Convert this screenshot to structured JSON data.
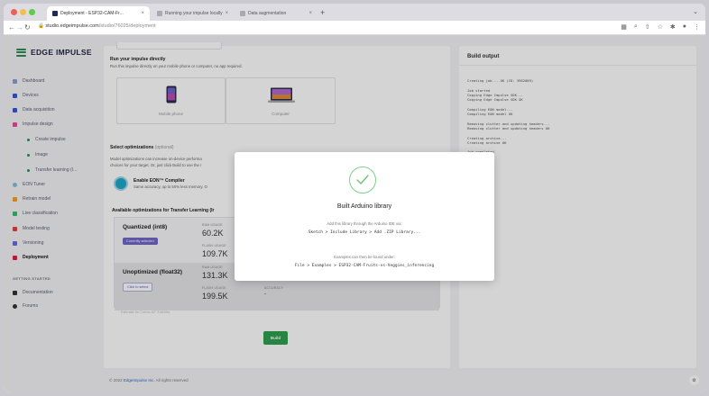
{
  "browser": {
    "tabs": [
      {
        "label": "Deployment - ESP32-CAM-Fr..."
      },
      {
        "label": "Running your impulse locally"
      },
      {
        "label": "Data augmentation"
      }
    ],
    "new_tab": "+",
    "url_host": "studio.edgeimpulse.com",
    "url_path": "/studio/76025/deployment"
  },
  "app": {
    "brand": "EDGE IMPULSE",
    "nav": [
      {
        "label": "Dashboard",
        "color": "#8aa0c8"
      },
      {
        "label": "Devices",
        "color": "#3a58c9"
      },
      {
        "label": "Data acquisition",
        "color": "#3a58c9"
      },
      {
        "label": "Impulse design",
        "color": "#e0509a"
      }
    ],
    "subnav": [
      "Create impulse",
      "Image",
      "Transfer learning (I..."
    ],
    "nav2": [
      {
        "label": "EON Tuner",
        "color": "#7fc2d9"
      },
      {
        "label": "Retrain model",
        "color": "#f0a030"
      },
      {
        "label": "Live classification",
        "color": "#40b870"
      },
      {
        "label": "Model testing",
        "color": "#e04040"
      },
      {
        "label": "Versioning",
        "color": "#6a6adc"
      },
      {
        "label": "Deployment",
        "color": "#e02040"
      }
    ],
    "section": "GETTING STARTED",
    "nav3": [
      {
        "label": "Documentation",
        "color": "#333"
      },
      {
        "label": "Forums",
        "color": "#333"
      }
    ]
  },
  "main": {
    "run_title": "Run your impulse directly",
    "run_text": "Run this impulse directly on your mobile phone or computer, no app required.",
    "mobile_label": "Mobile phone",
    "computer_label": "Computer",
    "opt_title": "Select optimizations",
    "opt_title_suffix": "(optional)",
    "opt_text1": "Model optimizations can increase on-device performa",
    "opt_text2": "choices for your target. Or, just click Build to use the r",
    "eon_title": "Enable EON™ Compiler",
    "eon_text": "Same accuracy, up to 50% less memory. O",
    "available": "Available optimizations for Transfer Learning (Ir",
    "quantized": {
      "name": "Quantized (int8)",
      "badge": "Currently selected",
      "ram_label": "RAM USAGE",
      "ram": "60.2K",
      "flash_label": "FLASH USAGE",
      "flash": "109.7K"
    },
    "unoptimized": {
      "name": "Unoptimized (float32)",
      "badge": "Click to select",
      "ram_label": "RAM USAGE",
      "ram": "131.3K",
      "flash_label": "FLASH USAGE",
      "flash": "199.5K",
      "acc_label": "ACCURACY",
      "acc": "-"
    },
    "eon_note": "Estimate for Cortex-M7 216MHz",
    "build": "Build",
    "footer_prefix": "© 2022 ",
    "footer_link": "EdgeImpulse Inc.",
    "footer_suffix": " All rights reserved"
  },
  "build_output": {
    "title": "Build output",
    "lines": "Creating job... OK (ID: 3982089)\n\nJob started\nCopying Edge Impulse SDK...\nCopying Edge Impulse SDK OK\n\nCompiling EON model...\nCompiling EON model OK\n\nRemoving clutter and updating headers...\nRemoving clutter and updating headers OK\n\nCreating archive...\nCreating archive OK\n\nJob completed"
  },
  "modal": {
    "title": "Built Arduino library",
    "text1": "Add this library through the Arduino IDE via:",
    "code1": "Sketch > Include Library > Add .ZIP Library...",
    "text2": "Examples can then be found under:",
    "code2": "File > Examples > ESP32-CAM-Fruits-vs-Veggies_inferencing"
  }
}
